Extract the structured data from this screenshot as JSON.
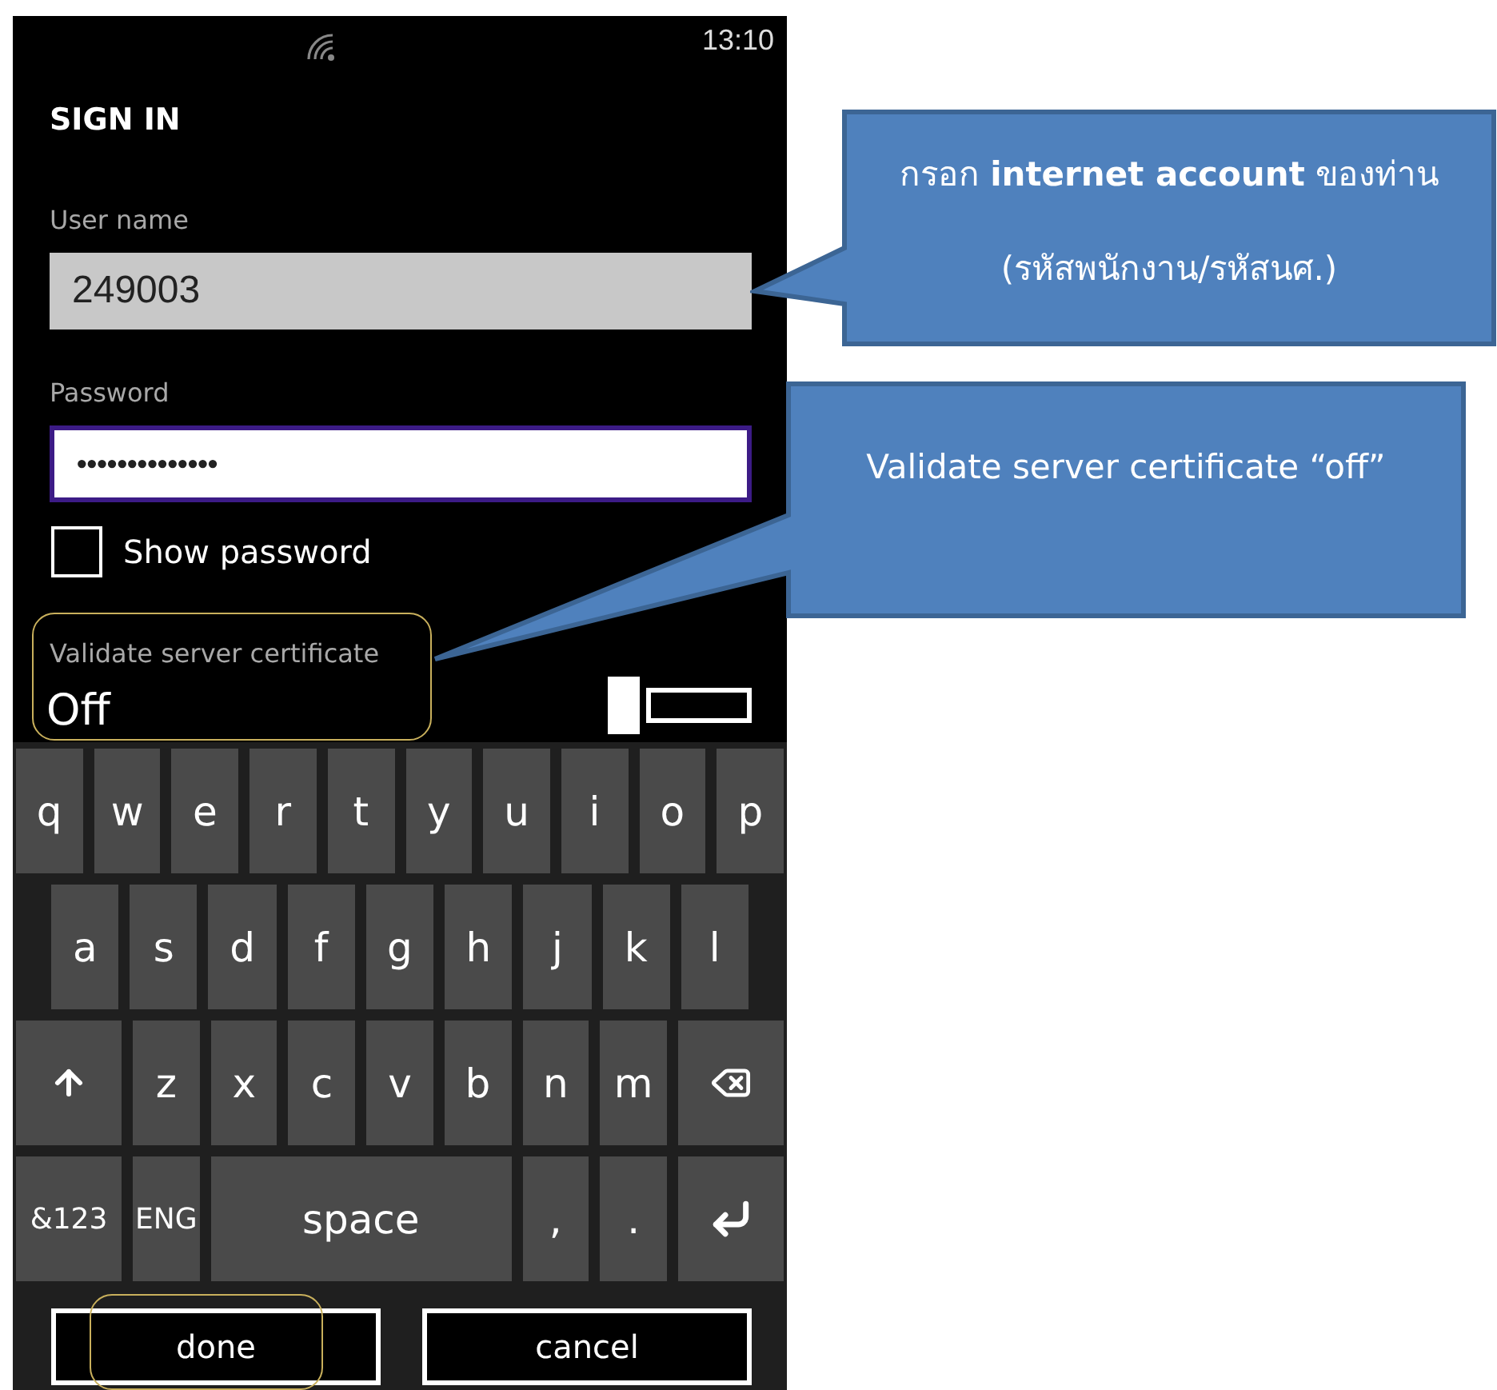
{
  "status_bar": {
    "time": "13:10"
  },
  "title": "SIGN IN",
  "fields": [
    {
      "label": "User name",
      "value": "249003",
      "focused": false
    },
    {
      "label": "Password",
      "value": "••••••••••••••",
      "focused": true
    }
  ],
  "show_password": {
    "label": "Show password",
    "checked": false
  },
  "validate_certificate": {
    "label": "Validate server certificate",
    "value": "Off",
    "on": false
  },
  "keyboard": {
    "rows": [
      {
        "keys": [
          {
            "kind": "key",
            "label": "q"
          },
          {
            "kind": "key",
            "label": "w"
          },
          {
            "kind": "key",
            "label": "e"
          },
          {
            "kind": "key",
            "label": "r"
          },
          {
            "kind": "key",
            "label": "t"
          },
          {
            "kind": "key",
            "label": "y"
          },
          {
            "kind": "key",
            "label": "u"
          },
          {
            "kind": "key",
            "label": "i"
          },
          {
            "kind": "key",
            "label": "o"
          },
          {
            "kind": "key",
            "label": "p"
          }
        ]
      },
      {
        "keys": [
          {
            "kind": "key",
            "label": "a"
          },
          {
            "kind": "key",
            "label": "s"
          },
          {
            "kind": "key",
            "label": "d"
          },
          {
            "kind": "key",
            "label": "f"
          },
          {
            "kind": "key",
            "label": "g"
          },
          {
            "kind": "key",
            "label": "h"
          },
          {
            "kind": "key",
            "label": "j"
          },
          {
            "kind": "key",
            "label": "k"
          },
          {
            "kind": "key",
            "label": "l"
          }
        ]
      },
      {
        "keys": [
          {
            "kind": "shift"
          },
          {
            "kind": "key",
            "label": "z"
          },
          {
            "kind": "key",
            "label": "x"
          },
          {
            "kind": "key",
            "label": "c"
          },
          {
            "kind": "key",
            "label": "v"
          },
          {
            "kind": "key",
            "label": "b"
          },
          {
            "kind": "key",
            "label": "n"
          },
          {
            "kind": "key",
            "label": "m"
          },
          {
            "kind": "backspace"
          }
        ]
      },
      {
        "keys": [
          {
            "kind": "symbols",
            "label": "&123"
          },
          {
            "kind": "language",
            "label": "ENG"
          },
          {
            "kind": "space",
            "label": "space"
          },
          {
            "kind": "key",
            "label": ","
          },
          {
            "kind": "key",
            "label": "."
          },
          {
            "kind": "enter"
          }
        ]
      }
    ]
  },
  "actions": [
    {
      "label": "done"
    },
    {
      "label": "cancel"
    }
  ],
  "callouts": [
    {
      "text": "กรอก **internet account** ของท่าน",
      "subtext": "(รหัสพนักงาน/รหัสนศ.)"
    },
    {
      "text": "Validate server certificate “off”"
    }
  ]
}
